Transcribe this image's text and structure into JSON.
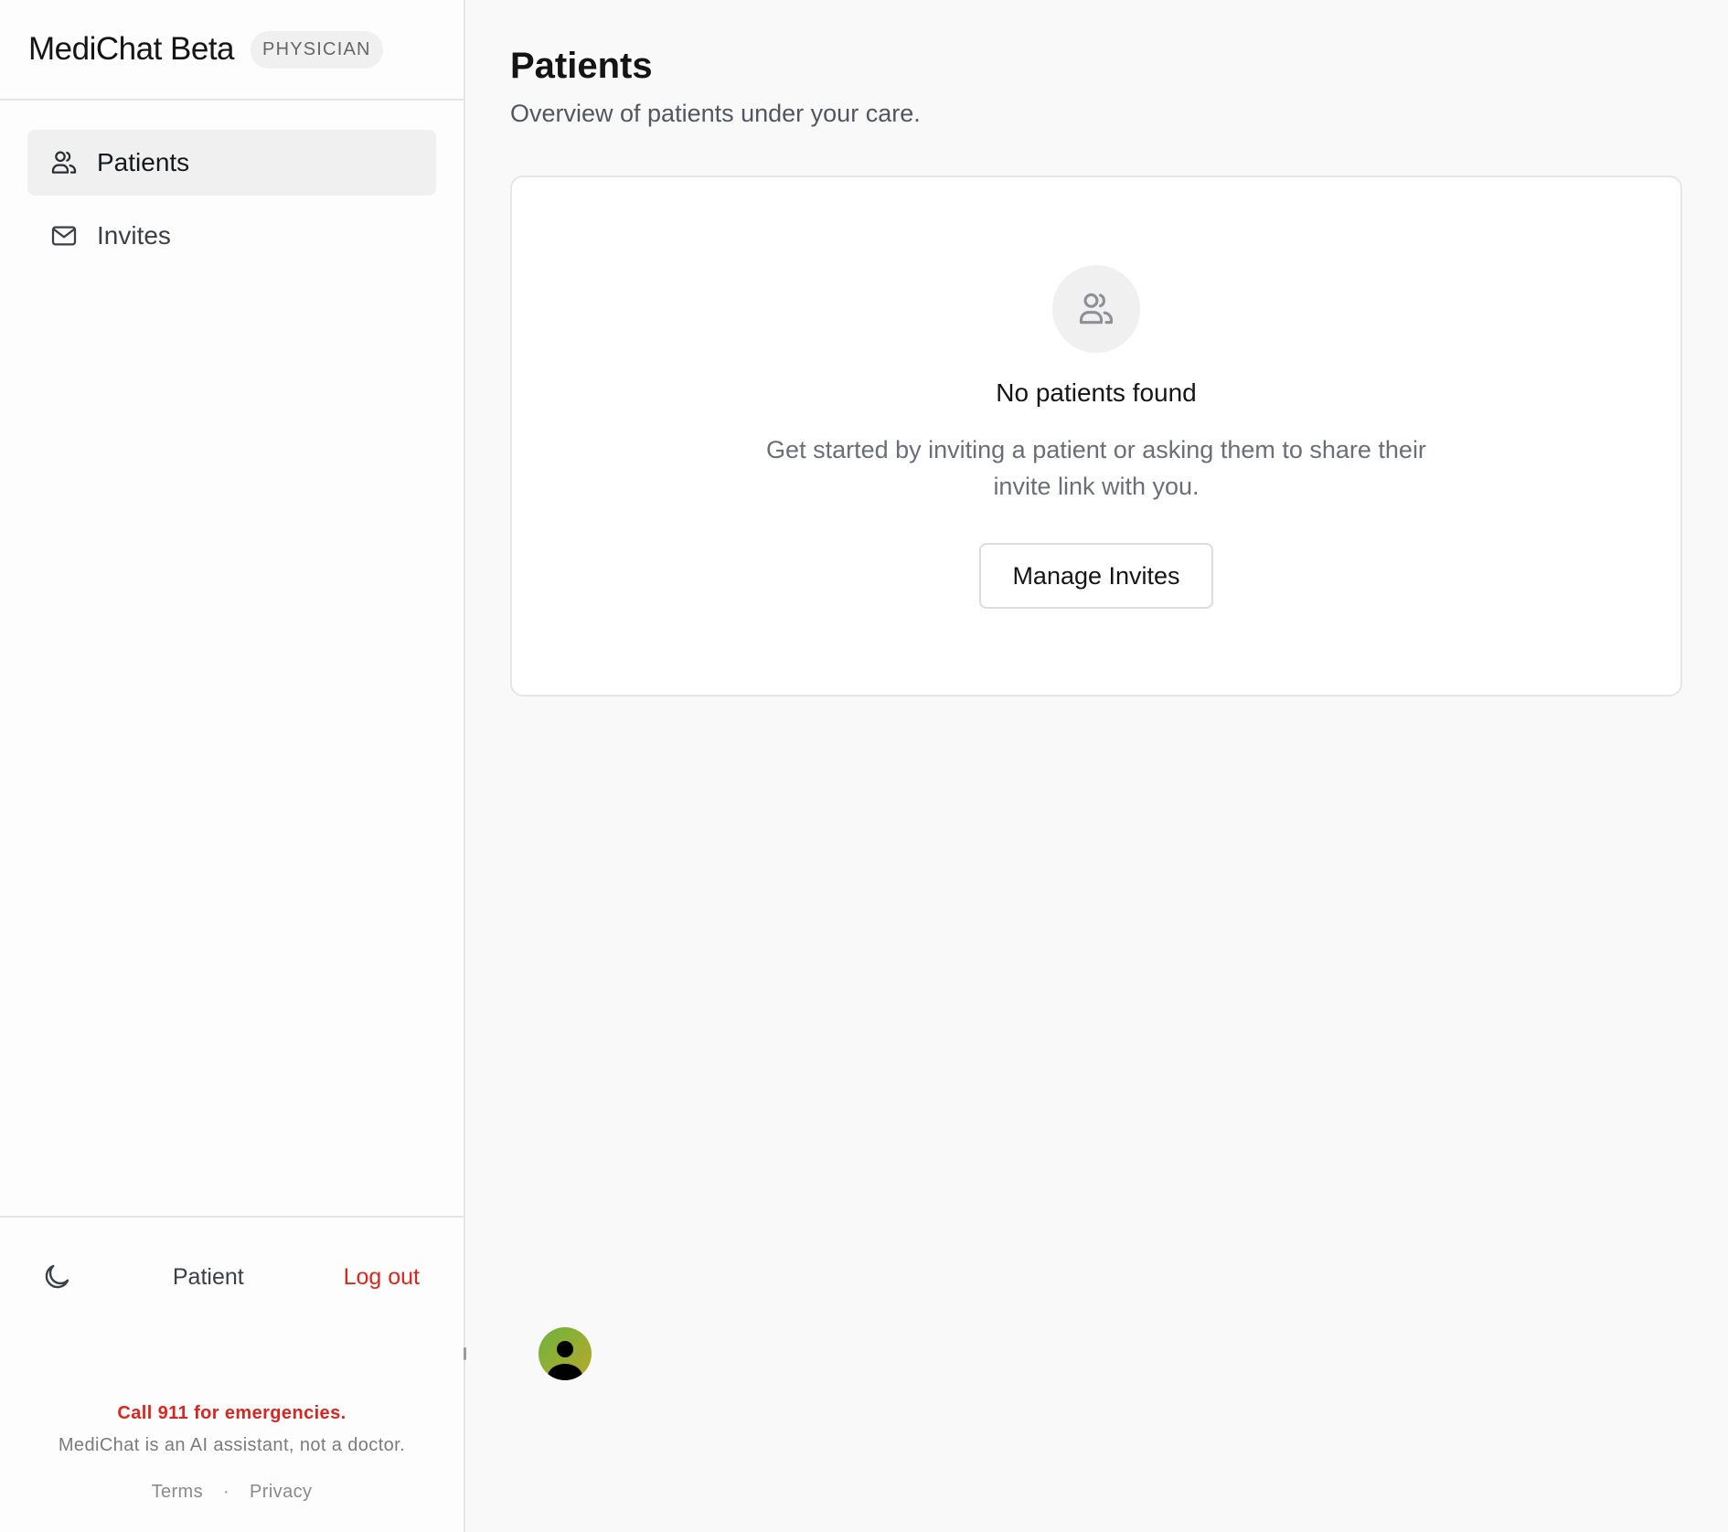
{
  "brand": {
    "name": "MediChat Beta",
    "role": "PHYSICIAN"
  },
  "nav": {
    "items": [
      {
        "label": "Patients",
        "icon": "users-icon",
        "active": true
      },
      {
        "label": "Invites",
        "icon": "mail-icon",
        "active": false
      }
    ]
  },
  "footer": {
    "theme_icon": "moon-icon",
    "switch_label": "Patient",
    "logout_label": "Log out",
    "emergency": "Call 911 for emergencies.",
    "note": "MediChat is an AI assistant, not a doctor.",
    "terms": "Terms",
    "separator": "·",
    "privacy": "Privacy"
  },
  "main": {
    "title": "Patients",
    "subtitle": "Overview of patients under your care.",
    "empty": {
      "icon": "users-icon",
      "title": "No patients found",
      "description": "Get started by inviting a patient or asking them to share their invite link with you.",
      "button": "Manage Invites"
    }
  },
  "colors": {
    "danger": "#d9261f",
    "active_nav_bg": "#f0f0f0",
    "border": "#e6e6e6",
    "avatar_gradient_start": "#6db33f",
    "avatar_gradient_end": "#b9a92a"
  }
}
